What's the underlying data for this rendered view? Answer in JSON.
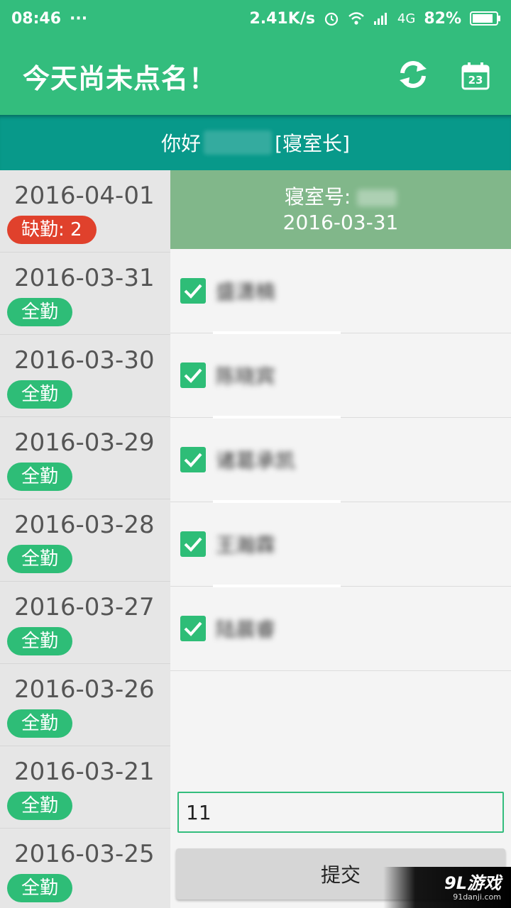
{
  "status_bar": {
    "time": "08:46",
    "more": "···",
    "speed": "2.41K/s",
    "network": "4G",
    "battery": "82%"
  },
  "app_bar": {
    "title": "今天尚未点名！",
    "refresh_icon": "refresh-icon",
    "calendar_icon": "calendar-icon",
    "calendar_day": "23"
  },
  "greeting": {
    "prefix": "你好",
    "role": "[寝室长]"
  },
  "dates": [
    {
      "date": "2016-04-01",
      "status": "缺勤: 2",
      "kind": "absent"
    },
    {
      "date": "2016-03-31",
      "status": "全勤",
      "kind": "full"
    },
    {
      "date": "2016-03-30",
      "status": "全勤",
      "kind": "full"
    },
    {
      "date": "2016-03-29",
      "status": "全勤",
      "kind": "full"
    },
    {
      "date": "2016-03-28",
      "status": "全勤",
      "kind": "full"
    },
    {
      "date": "2016-03-27",
      "status": "全勤",
      "kind": "full"
    },
    {
      "date": "2016-03-26",
      "status": "全勤",
      "kind": "full"
    },
    {
      "date": "2016-03-21",
      "status": "全勤",
      "kind": "full"
    },
    {
      "date": "2016-03-25",
      "status": "全勤",
      "kind": "full"
    }
  ],
  "room": {
    "label": "寝室号:",
    "date": "2016-03-31"
  },
  "members": [
    {
      "name": "盛潇楠",
      "checked": true
    },
    {
      "name": "陈晓宾",
      "checked": true
    },
    {
      "name": "诸葛承凯",
      "checked": true
    },
    {
      "name": "王瀚霖",
      "checked": true
    },
    {
      "name": "陆晨睿",
      "checked": true
    }
  ],
  "input": {
    "value": "11"
  },
  "submit": {
    "label": "提交"
  },
  "watermark": {
    "main": "9L游戏",
    "sub": "91danji.com"
  },
  "colors": {
    "primary": "#33bd7d",
    "teal": "#08998a",
    "room_header": "#81b78a",
    "absent": "#e0412c",
    "full": "#2ebd77"
  }
}
